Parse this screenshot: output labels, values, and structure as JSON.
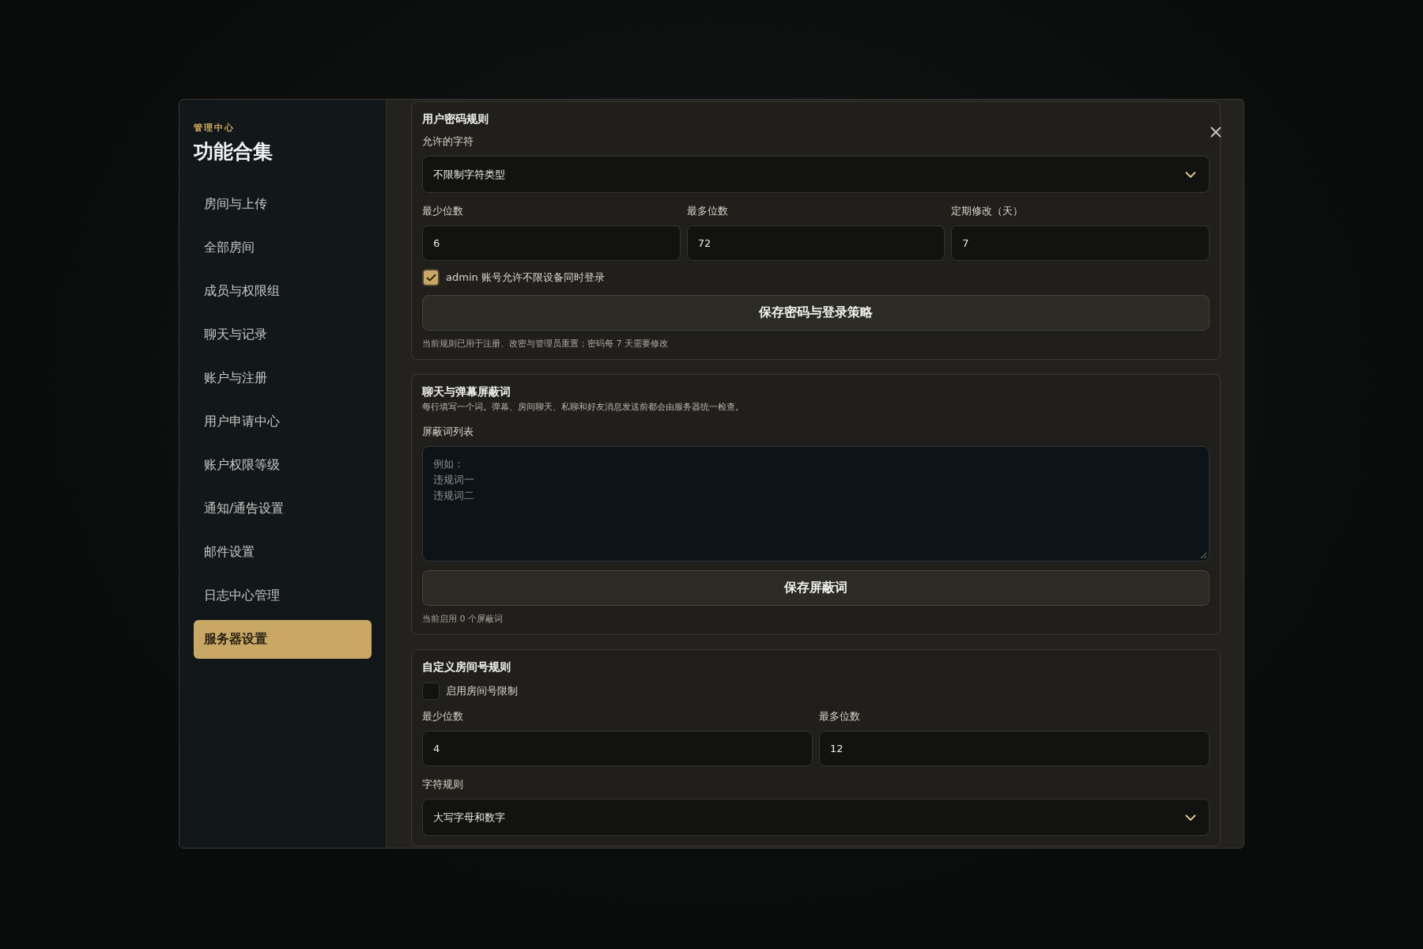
{
  "sidebar": {
    "eyebrow": "管理中心",
    "title": "功能合集",
    "items": [
      {
        "label": "房间与上传",
        "selected": false
      },
      {
        "label": "全部房间",
        "selected": false
      },
      {
        "label": "成员与权限组",
        "selected": false
      },
      {
        "label": "聊天与记录",
        "selected": false
      },
      {
        "label": "账户与注册",
        "selected": false
      },
      {
        "label": "用户申请中心",
        "selected": false
      },
      {
        "label": "账户权限等级",
        "selected": false
      },
      {
        "label": "通知/通告设置",
        "selected": false
      },
      {
        "label": "邮件设置",
        "selected": false
      },
      {
        "label": "日志中心管理",
        "selected": false
      },
      {
        "label": "服务器设置",
        "selected": true
      }
    ]
  },
  "password_rules": {
    "title": "用户密码规则",
    "charset_label": "允许的字符",
    "charset_value": "不限制字符类型",
    "fields": [
      {
        "label": "最少位数",
        "value": "6"
      },
      {
        "label": "最多位数",
        "value": "72"
      },
      {
        "label": "定期修改（天）",
        "value": "7"
      }
    ],
    "checkbox": {
      "label": "admin 账号允许不限设备同时登录",
      "checked": true
    },
    "save_button": "保存密码与登录策略",
    "hint": "当前规则已用于注册、改密与管理员重置；密码每 7 天需要修改"
  },
  "chat_filter": {
    "title": "聊天与弹幕屏蔽词",
    "description": "每行填写一个词。弹幕、房间聊天、私聊和好友消息发送前都会由服务器统一检查。",
    "list_label": "屏蔽词列表",
    "placeholder_lines": [
      "例如：",
      "违规词一",
      "违规词二"
    ],
    "save_button": "保存屏蔽词",
    "hint": "当前启用 0 个屏蔽词"
  },
  "room_rules": {
    "title": "自定义房间号规则",
    "checkbox": {
      "label": "启用房间号限制",
      "checked": false
    },
    "fields": [
      {
        "label": "最少位数",
        "value": "4"
      },
      {
        "label": "最多位数",
        "value": "12"
      }
    ],
    "charset_label": "字符规则",
    "charset_value": "大写字母和数字"
  }
}
